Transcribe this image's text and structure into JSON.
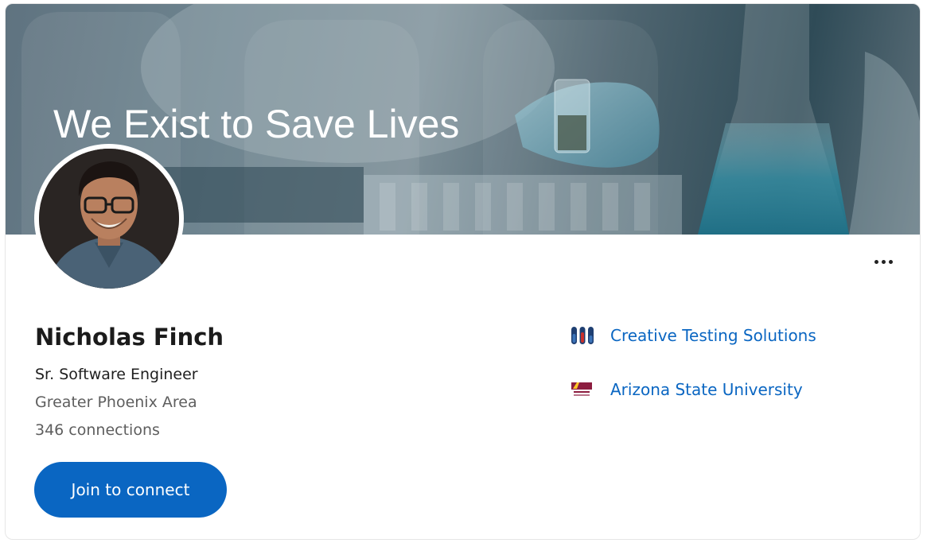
{
  "banner": {
    "title": "We Exist to Save Lives"
  },
  "profile": {
    "name": "Nicholas Finch",
    "headline": "Sr. Software Engineer",
    "location": "Greater Phoenix Area",
    "connections": "346 connections"
  },
  "actions": {
    "join_label": "Join to connect",
    "more_icon": "more-horizontal-icon"
  },
  "organizations": [
    {
      "name": "Creative Testing Solutions",
      "logo": "test-tubes-logo"
    },
    {
      "name": "Arizona State University",
      "logo": "asu-logo"
    }
  ],
  "colors": {
    "link": "#0a66c2",
    "button": "#0a66c2"
  }
}
